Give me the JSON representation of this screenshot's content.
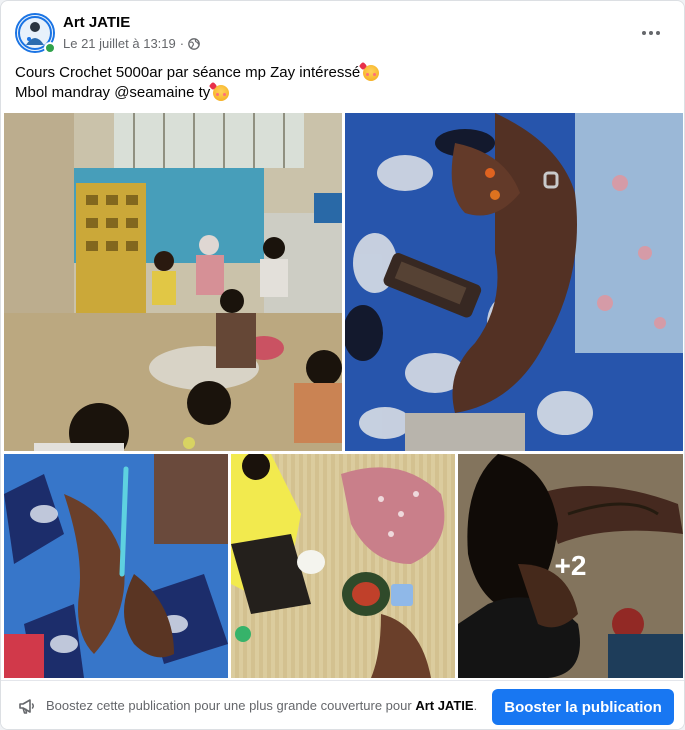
{
  "post": {
    "author": "Art JATIE",
    "timestamp": "Le 21 juillet à 13:19",
    "separator": "·",
    "audience_icon": "globe-icon",
    "text_line1": "Cours Crochet 5000ar par séance mp Zay intéressé",
    "text_line2": "Mbol mandray @seamaine ty",
    "emoji": "smiling-face-with-hearts"
  },
  "photos": {
    "more_count_label": "+2"
  },
  "footer": {
    "boost_prefix": "Boostez cette publication pour une plus grande couverture pour",
    "boost_name": "Art JATIE",
    "boost_suffix": ".",
    "boost_button": "Booster la publication"
  },
  "colors": {
    "accent": "#1877f2",
    "online": "#31a24c",
    "secondary_text": "#65676b"
  }
}
